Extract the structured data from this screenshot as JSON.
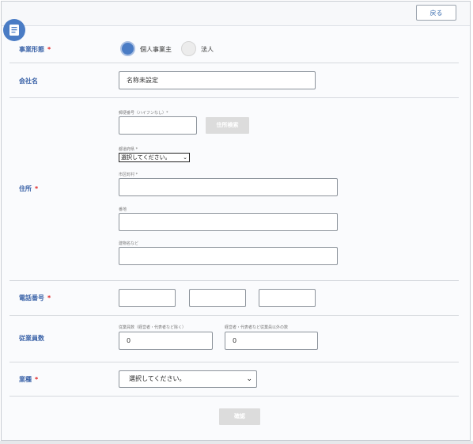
{
  "header": {
    "back_label": "戻る"
  },
  "business_type": {
    "label": "事業形態",
    "required_mark": "*",
    "options": [
      {
        "label": "個人事業主",
        "selected": true
      },
      {
        "label": "法人",
        "selected": false
      }
    ]
  },
  "company_name": {
    "label": "会社名",
    "value": "名称未設定"
  },
  "address": {
    "label": "住所",
    "required_mark": "*",
    "postal_label": "郵便番号（ハイフンなし）*",
    "postal_value": "",
    "search_button": "住所検索",
    "prefecture_label": "都道府県 *",
    "prefecture_value": "選択してください。",
    "city_label": "市区町村 *",
    "city_value": "",
    "street_label": "番地",
    "street_value": "",
    "building_label": "建物名など",
    "building_value": ""
  },
  "phone": {
    "label": "電話番号",
    "required_mark": "*",
    "parts": [
      "",
      "",
      ""
    ]
  },
  "employees": {
    "label": "従業員数",
    "count_label": "従業員数（経営者・代表者など除く）",
    "count_value": "0",
    "other_label": "経営者・代表者など従業員以外の数",
    "other_value": "0"
  },
  "industry": {
    "label": "業種",
    "required_mark": "*",
    "value": "選択してください。"
  },
  "confirm_label": "確認",
  "colors": {
    "accent": "#4a7cc5",
    "label": "#3b63a8",
    "required": "#e02020",
    "disabled_button": "#dcdcdc"
  }
}
